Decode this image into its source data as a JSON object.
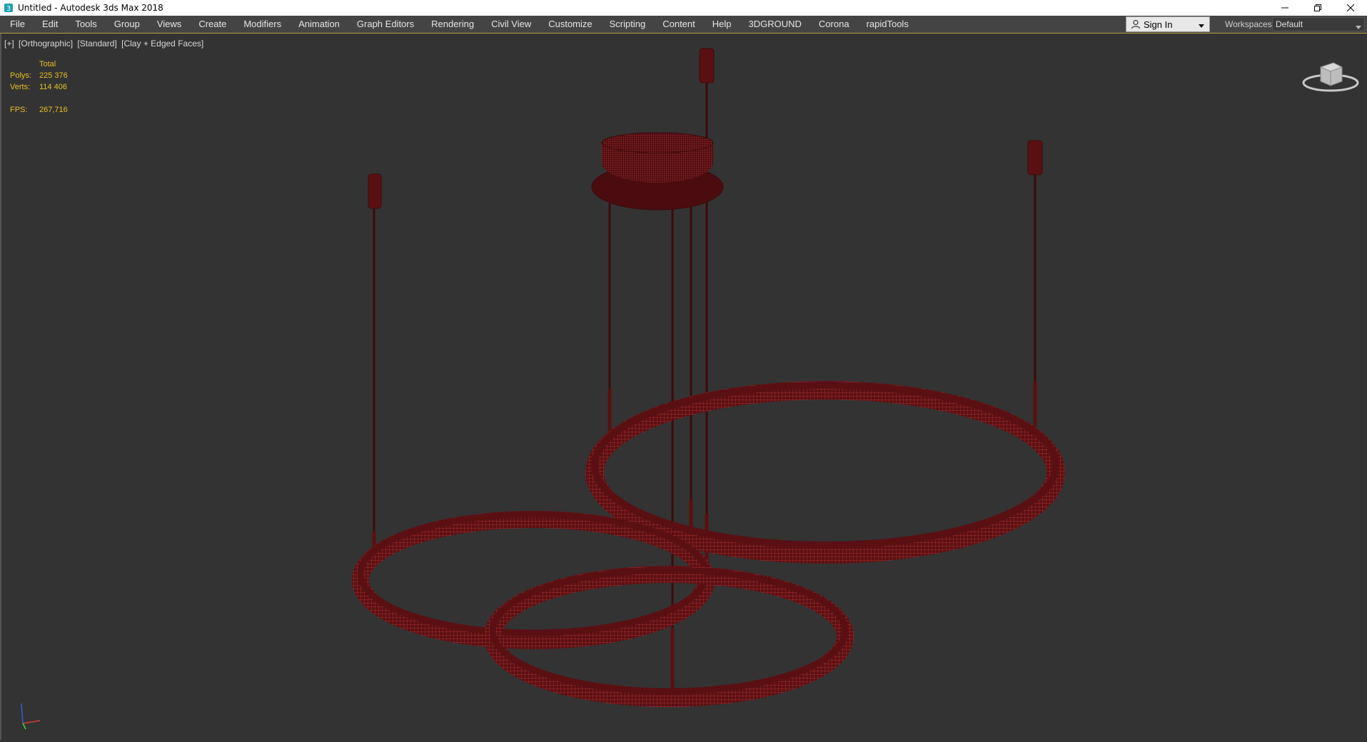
{
  "window": {
    "title": "Untitled - Autodesk 3ds Max 2018",
    "app_icon": "3dsmax-icon",
    "controls": [
      "minimize-icon",
      "restore-icon",
      "close-icon"
    ]
  },
  "menubar": {
    "items": [
      "File",
      "Edit",
      "Tools",
      "Group",
      "Views",
      "Create",
      "Modifiers",
      "Animation",
      "Graph Editors",
      "Rendering",
      "Civil View",
      "Customize",
      "Scripting",
      "Content",
      "Help",
      "3DGROUND",
      "Corona",
      "rapidTools"
    ]
  },
  "account": {
    "signin_label": "Sign In",
    "workspaces_label": "Workspaces:",
    "workspace_value": "Default"
  },
  "viewport": {
    "labels": [
      "[+]",
      "[Orthographic]",
      "[Standard]",
      "[Clay + Edged Faces]"
    ],
    "stats": {
      "header": "Total",
      "polys_label": "Polys:",
      "polys_value": "225 376",
      "verts_label": "Verts:",
      "verts_value": "114 406",
      "fps_label": "FPS:",
      "fps_value": "267,716"
    },
    "model_color": "#5a1012",
    "edge_color": "#c0393f"
  }
}
